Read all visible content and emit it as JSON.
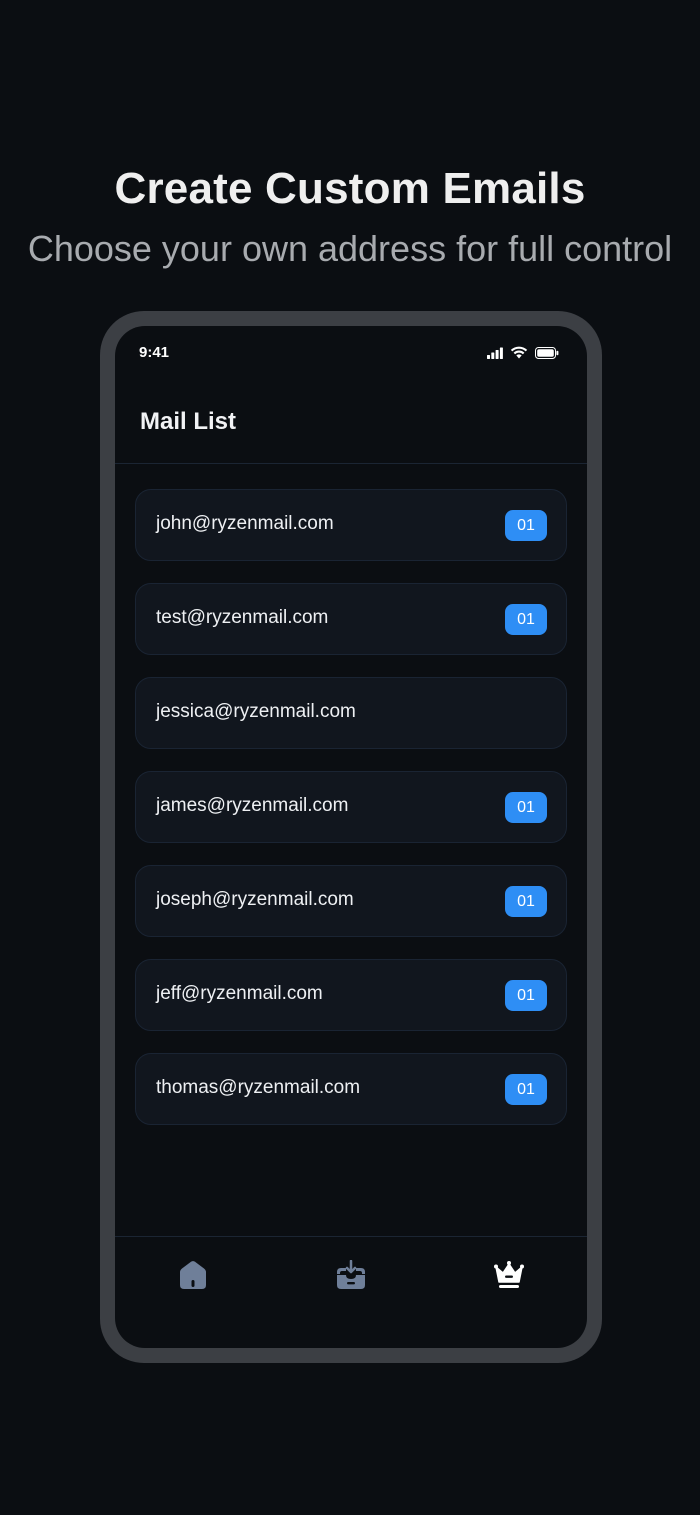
{
  "hero": {
    "title": "Create Custom Emails",
    "subtitle": "Choose your own address for full control"
  },
  "status_bar": {
    "time": "9:41",
    "icons": [
      "signal-icon",
      "wifi-icon",
      "battery-icon"
    ]
  },
  "header": {
    "title": "Mail List"
  },
  "mail_list": [
    {
      "address": "john@ryzenmail.com",
      "badge": "01"
    },
    {
      "address": "test@ryzenmail.com",
      "badge": "01"
    },
    {
      "address": "jessica@ryzenmail.com",
      "badge": ""
    },
    {
      "address": "james@ryzenmail.com",
      "badge": "01"
    },
    {
      "address": "joseph@ryzenmail.com",
      "badge": "01"
    },
    {
      "address": "jeff@ryzenmail.com",
      "badge": "01"
    },
    {
      "address": "thomas@ryzenmail.com",
      "badge": "01"
    }
  ],
  "bottom_nav": {
    "items": [
      {
        "icon": "home-icon",
        "active": false
      },
      {
        "icon": "inbox-icon",
        "active": false
      },
      {
        "icon": "crown-icon",
        "active": true
      }
    ]
  },
  "colors": {
    "background": "#0b0e12",
    "card": "#11161e",
    "badge": "#2e8ef5",
    "nav_inactive": "#6f7f99",
    "nav_active": "#ffffff"
  }
}
